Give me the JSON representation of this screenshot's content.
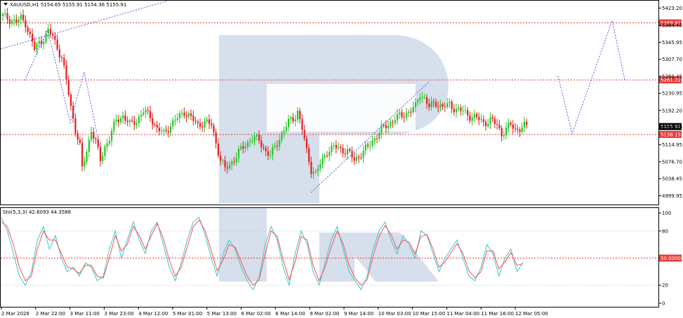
{
  "header": {
    "symbol": "XAUUSD,H1",
    "ohlc": "5154.65 5155.91 5154.36 5155.91",
    "indicator_title": "Sto(5,3,3) 42.6093 44.3588"
  },
  "colors": {
    "bull": "#22c822",
    "bear": "#e01e1e",
    "level": "#e83a3a",
    "forecast": "#5a5ae0",
    "stoch_main": "#3cc8c8",
    "stoch_signal": "#ff5050",
    "watermark": "#c8d4e6"
  },
  "chart_data": [
    {
      "type": "candlestick",
      "title": "XAUUSD,H1",
      "ylim": [
        4980,
        5440
      ],
      "y_ticks": [
        "5423.20",
        "5384.45",
        "5345.95",
        "5307.70",
        "5269.45",
        "5230.95",
        "5192.20",
        "5153.70",
        "5114.95",
        "5076.70",
        "5038.45",
        "4999.95"
      ],
      "current_price": "5155.91",
      "levels": [
        {
          "price": 5389.92,
          "label": "5389.92"
        },
        {
          "price": 5261.22,
          "label": "5261.22"
        },
        {
          "price": 5138.15,
          "label": "5138.15"
        }
      ],
      "x_labels": [
        "2 Mar 2026",
        "2 Mar 22:00",
        "3 Mar 11:00",
        "3 Mar 23:00",
        "4 Mar 12:00",
        "5 Mar 01:00",
        "5 Mar 13:00",
        "6 Mar 02:00",
        "6 Mar 14:00",
        "9 Mar 02:00",
        "9 Mar 14:00",
        "10 Mar 03:00",
        "10 Mar 15:00",
        "11 Mar 04:00",
        "11 Mar 16:00",
        "12 Mar 05:00"
      ],
      "close_path": [
        [
          0,
          5405
        ],
        [
          3,
          5398
        ],
        [
          6,
          5392
        ],
        [
          8,
          5400
        ],
        [
          10,
          5390
        ],
        [
          12,
          5360
        ],
        [
          14,
          5330
        ],
        [
          16,
          5345
        ],
        [
          18,
          5355
        ],
        [
          20,
          5370
        ],
        [
          22,
          5360
        ],
        [
          24,
          5335
        ],
        [
          26,
          5310
        ],
        [
          28,
          5260
        ],
        [
          30,
          5200
        ],
        [
          32,
          5150
        ],
        [
          34,
          5110
        ],
        [
          35,
          5060
        ],
        [
          37,
          5100
        ],
        [
          39,
          5150
        ],
        [
          41,
          5120
        ],
        [
          43,
          5080
        ],
        [
          45,
          5110
        ],
        [
          47,
          5130
        ],
        [
          50,
          5170
        ],
        [
          53,
          5180
        ],
        [
          56,
          5160
        ],
        [
          59,
          5170
        ],
        [
          62,
          5190
        ],
        [
          65,
          5180
        ],
        [
          68,
          5150
        ],
        [
          71,
          5140
        ],
        [
          74,
          5160
        ],
        [
          77,
          5175
        ],
        [
          80,
          5190
        ],
        [
          83,
          5175
        ],
        [
          86,
          5160
        ],
        [
          89,
          5165
        ],
        [
          92,
          5160
        ],
        [
          94,
          5120
        ],
        [
          96,
          5080
        ],
        [
          98,
          5060
        ],
        [
          100,
          5070
        ],
        [
          103,
          5090
        ],
        [
          106,
          5110
        ],
        [
          108,
          5120
        ],
        [
          110,
          5130
        ],
        [
          113,
          5125
        ],
        [
          116,
          5100
        ],
        [
          118,
          5090
        ],
        [
          120,
          5110
        ],
        [
          123,
          5140
        ],
        [
          126,
          5165
        ],
        [
          129,
          5180
        ],
        [
          130,
          5190
        ],
        [
          132,
          5150
        ],
        [
          134,
          5100
        ],
        [
          136,
          5060
        ],
        [
          138,
          5050
        ],
        [
          140,
          5070
        ],
        [
          143,
          5100
        ],
        [
          146,
          5110
        ],
        [
          149,
          5105
        ],
        [
          152,
          5100
        ],
        [
          155,
          5080
        ],
        [
          158,
          5095
        ],
        [
          161,
          5110
        ],
        [
          164,
          5130
        ],
        [
          167,
          5150
        ],
        [
          170,
          5160
        ],
        [
          173,
          5175
        ],
        [
          176,
          5180
        ],
        [
          179,
          5190
        ],
        [
          182,
          5200
        ],
        [
          184,
          5230
        ],
        [
          186,
          5220
        ],
        [
          188,
          5200
        ],
        [
          191,
          5210
        ],
        [
          194,
          5200
        ],
        [
          197,
          5205
        ],
        [
          200,
          5195
        ],
        [
          203,
          5190
        ],
        [
          206,
          5180
        ],
        [
          209,
          5175
        ],
        [
          212,
          5165
        ],
        [
          215,
          5170
        ],
        [
          218,
          5160
        ],
        [
          220,
          5140
        ],
        [
          222,
          5150
        ],
        [
          224,
          5160
        ],
        [
          226,
          5150
        ],
        [
          228,
          5152
        ],
        [
          230,
          5156
        ]
      ],
      "forecast_path": [
        [
          0,
          5270
        ],
        [
          1,
          5140
        ],
        [
          2,
          5260
        ],
        [
          3,
          5395
        ],
        [
          4,
          5262
        ]
      ],
      "watermark": "R"
    },
    {
      "type": "line",
      "title": "Sto(5,3,3) 42.6093 44.3588",
      "ylim": [
        0,
        100
      ],
      "y_ticks": [
        "100",
        "80",
        "20",
        "0"
      ],
      "level": {
        "value": 50,
        "label": "50.0000"
      },
      "series": [
        {
          "name": "",
          "values": [
            95,
            80,
            55,
            30,
            20,
            35,
            70,
            85,
            60,
            75,
            50,
            35,
            40,
            30,
            45,
            40,
            25,
            30,
            60,
            80,
            50,
            70,
            90,
            70,
            55,
            80,
            90,
            65,
            40,
            25,
            45,
            70,
            90,
            95,
            75,
            50,
            30,
            55,
            70,
            60,
            40,
            25,
            15,
            30,
            65,
            85,
            70,
            40,
            20,
            55,
            80,
            65,
            35,
            20,
            45,
            70,
            85,
            60,
            35,
            25,
            15,
            30,
            60,
            80,
            90,
            70,
            55,
            75,
            65,
            50,
            80,
            75,
            55,
            35,
            50,
            60,
            70,
            50,
            30,
            25,
            40,
            65,
            55,
            30,
            50,
            60,
            35,
            45
          ]
        },
        {
          "name": "",
          "values": [
            90,
            85,
            65,
            40,
            25,
            30,
            60,
            80,
            70,
            70,
            55,
            40,
            38,
            33,
            42,
            42,
            30,
            28,
            50,
            75,
            58,
            65,
            85,
            75,
            60,
            75,
            88,
            72,
            48,
            30,
            40,
            62,
            85,
            92,
            80,
            58,
            36,
            48,
            65,
            62,
            46,
            30,
            20,
            26,
            55,
            80,
            74,
            48,
            26,
            46,
            74,
            70,
            42,
            25,
            40,
            62,
            80,
            66,
            42,
            28,
            20,
            26,
            52,
            74,
            86,
            76,
            60,
            70,
            68,
            55,
            74,
            76,
            60,
            40,
            46,
            56,
            66,
            55,
            36,
            28,
            35,
            58,
            58,
            38,
            46,
            56,
            42,
            44
          ]
        }
      ]
    }
  ]
}
